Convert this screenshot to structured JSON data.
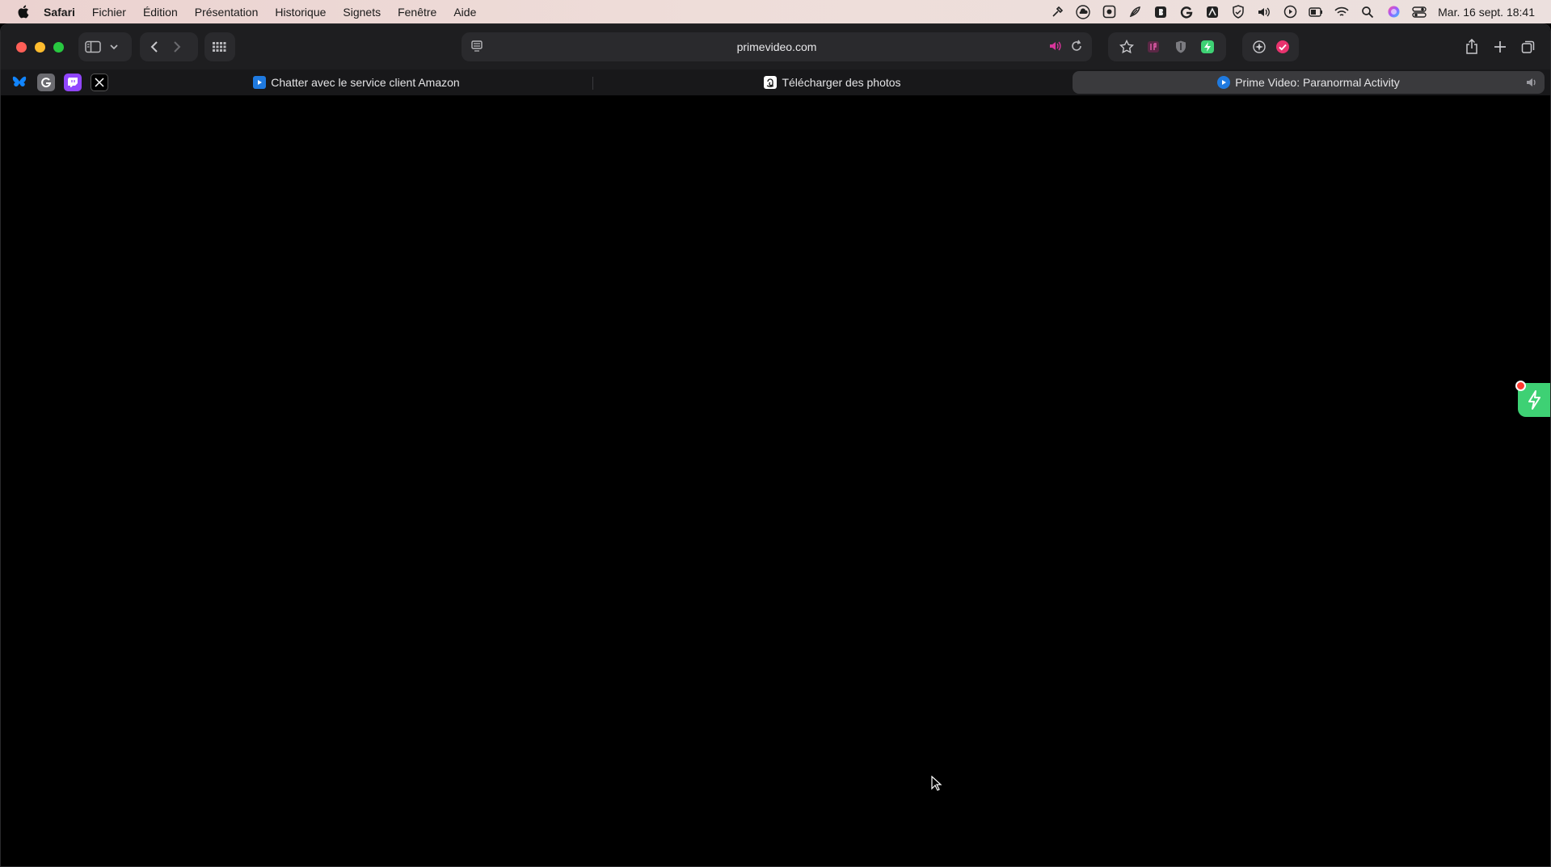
{
  "menubar": {
    "app_name": "Safari",
    "items": [
      "Fichier",
      "Édition",
      "Présentation",
      "Historique",
      "Signets",
      "Fenêtre",
      "Aide"
    ],
    "clock": "Mar. 16 sept.  18:41",
    "status_icons": [
      "hammer-icon",
      "cloud-icon",
      "photo-icon",
      "feather-icon",
      "b-app-icon",
      "g-app-icon",
      "a-app-icon",
      "shield-icon",
      "volume-icon",
      "play-icon",
      "battery-icon",
      "wifi-icon",
      "search-icon",
      "siri-icon",
      "control-center-icon"
    ]
  },
  "toolbar": {
    "url": "primevideo.com",
    "colors": {
      "close": "#ff5f57",
      "minimize": "#febc2e",
      "zoom": "#28c840"
    }
  },
  "tabs": {
    "pinned": [
      "bluesky-icon",
      "g-icon",
      "twitch-icon",
      "x-icon"
    ],
    "items": [
      {
        "label": "Chatter avec le service client Amazon",
        "active": false
      },
      {
        "label": "Télécharger des photos",
        "active": false
      },
      {
        "label": "Prime Video: Paranormal Activity",
        "active": true
      }
    ]
  }
}
